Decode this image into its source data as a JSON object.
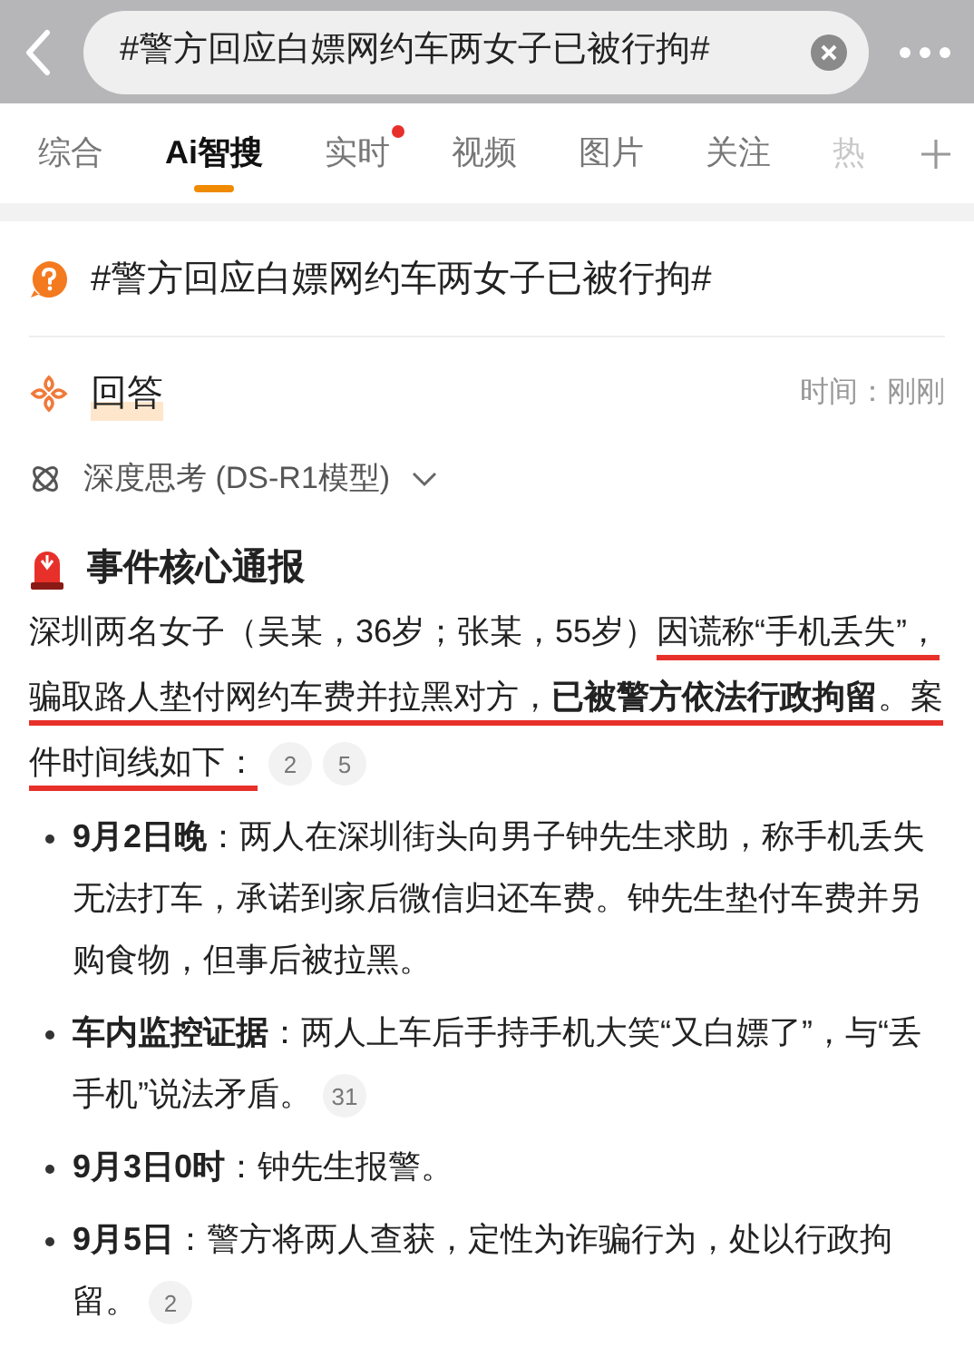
{
  "search_bar": {
    "value": "#警方回应白嫖网约车两女子已被行拘#"
  },
  "tabs": [
    {
      "label": "综合",
      "selected": false,
      "dot": false
    },
    {
      "label": "Ai智搜",
      "selected": true,
      "dot": false
    },
    {
      "label": "实时",
      "selected": false,
      "dot": true
    },
    {
      "label": "视频",
      "selected": false,
      "dot": false
    },
    {
      "label": "图片",
      "selected": false,
      "dot": false
    },
    {
      "label": "关注",
      "selected": false,
      "dot": false
    },
    {
      "label": "热",
      "selected": false,
      "dot": false
    }
  ],
  "question": "#警方回应白嫖网约车两女子已被行拘#",
  "answer": {
    "title": "回答",
    "time": "时间：刚刚",
    "model": "深度思考 (DS-R1模型)",
    "expanded": false
  },
  "section_title": "事件核心通报",
  "summary": {
    "segments": [
      {
        "text": "深圳两名女子（吴某，36岁；张某，55岁）",
        "bold": false,
        "underlined": false
      },
      {
        "text": "因谎称“手机丢失”，骗取路人垫付网约车费并拉黑对方，",
        "bold": false,
        "underlined": true
      },
      {
        "text": "已被警方依法行政拘留",
        "bold": true,
        "underlined": true
      },
      {
        "text": "。案件时间线如下：",
        "bold": false,
        "underlined": true
      }
    ],
    "citations": [
      "2",
      "5"
    ]
  },
  "timeline": [
    {
      "label": "9月2日晚",
      "text": "：两人在深圳街头向男子钟先生求助，称手机丢失无法打车，承诺到家后微信归还车费。钟先生垫付车费并另购食物，但事后被拉黑。"
    },
    {
      "label": "车内监控证据",
      "text": "：两人上车后手持手机大笑“又白嫖了”，与“丢手机”说法矛盾。",
      "citations": [
        "31"
      ]
    },
    {
      "label": "9月3日0时",
      "text": "：钟先生报警。"
    },
    {
      "label": "9月5日",
      "text": "：警方将两人查获，定性为诈骗行为，处以行政拘留。",
      "citations": [
        "2"
      ]
    }
  ]
}
